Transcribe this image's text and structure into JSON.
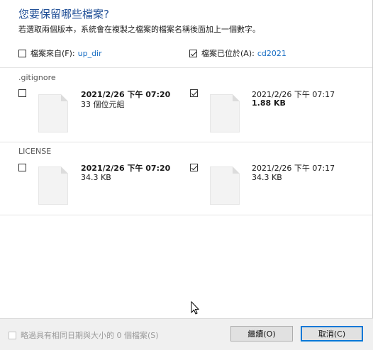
{
  "dialog": {
    "title": "您要保留哪些檔案?",
    "subtitle": "若選取兩個版本，系統會在複製之檔案的檔案名稱後面加上一個數字。"
  },
  "header": {
    "source_label": "檔案來自(F):",
    "source_link": "up_dir",
    "source_checked": false,
    "dest_label": "檔案已位於(A):",
    "dest_link": "cd2021",
    "dest_checked": true
  },
  "conflicts": [
    {
      "filename": ".gitignore",
      "source": {
        "date": "2021/2/26 下午 07:20",
        "size": "33 個位元組",
        "checked": false
      },
      "dest": {
        "date": "2021/2/26 下午 07:17",
        "size": "1.88 KB",
        "checked": true
      }
    },
    {
      "filename": "LICENSE",
      "source": {
        "date": "2021/2/26 下午 07:20",
        "size": "34.3 KB",
        "checked": false
      },
      "dest": {
        "date": "2021/2/26 下午 07:17",
        "size": "34.3 KB",
        "checked": true
      }
    }
  ],
  "footer": {
    "skip_same_label": "略過具有相同日期與大小的 0 個檔案(S)",
    "continue_label": "繼續(O)",
    "cancel_label": "取消(C)"
  }
}
